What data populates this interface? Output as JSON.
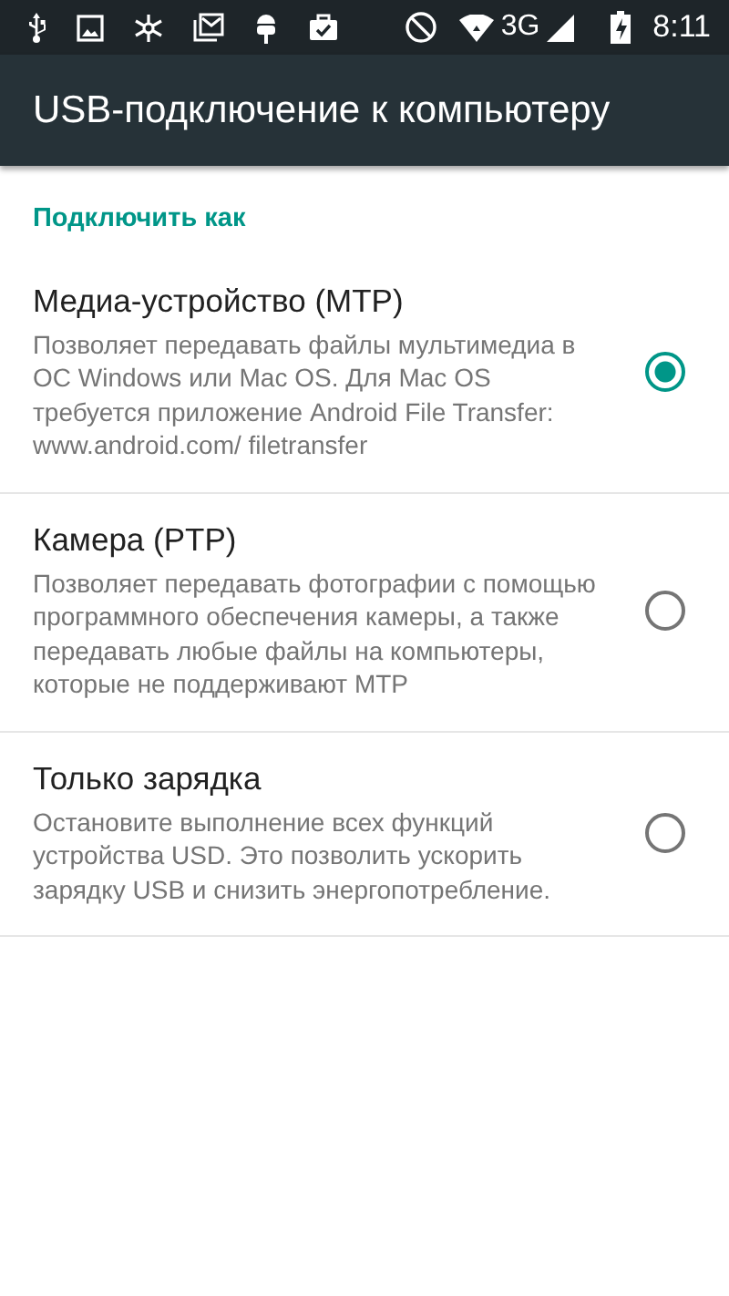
{
  "status_bar": {
    "network": "3G",
    "time": "8:11"
  },
  "toolbar": {
    "title": "USB-подключение к компьютеру"
  },
  "section": {
    "title": "Подключить как"
  },
  "options": [
    {
      "title": "Медиа-устройство (MTP)",
      "summary": "Позволяет передавать файлы мультимедиа в ОС Windows или Mac OS. Для Mac OS требуется приложение Android File Transfer: www.android.com/ filetransfer",
      "selected": true
    },
    {
      "title": "Камера (PTP)",
      "summary": "Позволяет передавать фотографии с помощью программного обеспечения камеры, а также передавать любые файлы на компьютеры, которые не поддерживают MTP",
      "selected": false
    },
    {
      "title": "Только зарядка",
      "summary": "Остановите выполнение всех функций устройства USD. Это позволить ускорить зарядку USB и снизить энергопотребление.",
      "selected": false
    }
  ]
}
